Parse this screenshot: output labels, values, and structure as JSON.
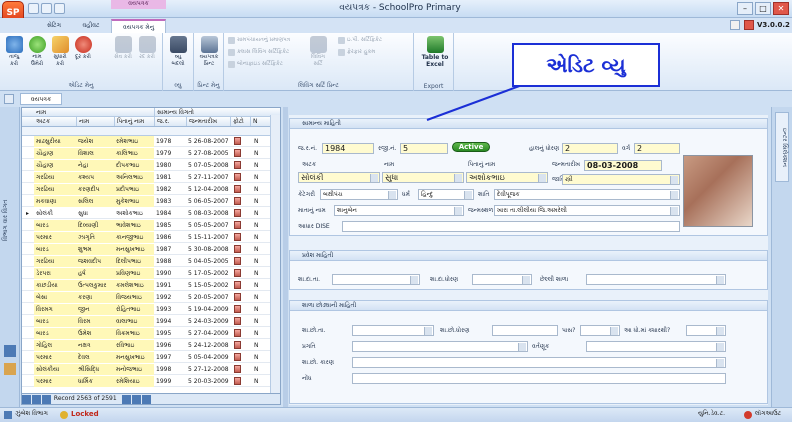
{
  "app": {
    "title": "વયપત્રક - SchoolPro Primary",
    "version": "V3.0.0.2",
    "logo": "SP"
  },
  "context_tab": "વયપત્રક",
  "ribbon_tabs": [
    "સેટિંગ",
    "વહીવટ",
    "વયપત્રક મેનુ"
  ],
  "ribbon": {
    "groups": [
      {
        "label": "એડિટ મેનુ",
        "buttons": [
          "તાજુ કરો",
          "નામ ઉમેરો",
          "સુધારો કરો",
          "દૂર કરો",
          "સેવ કરો",
          "રદ કરો"
        ]
      },
      {
        "label": "વ્યુ",
        "buttons": [
          "વ્યુ બદલો"
        ]
      },
      {
        "label": "પ્રિન્ટ મેનુ",
        "buttons": [
          "વયપત્રક પ્રિન્ટ"
        ]
      },
      {
        "label": "લિવિંગ સર્ટિ પ્રિન્ટ",
        "buttons": [
          "લિવિંગ સર્ટિ",
          "ન છ નબ મોડો"
        ]
      },
      {
        "label": "Export",
        "buttons": [
          "Table to Excel"
        ]
      }
    ],
    "small_items": [
      "ગ્રામપંચાયતનું પ્રમાણપત્ર",
      "ક્લાસ લિવિંગ સર્ટિફિકેટ",
      "બોનાફાઇડ સર્ટિફિકેટ",
      "ઇ.પી. સર્ટિફિકેટ",
      "ફેરફાર હુકમ"
    ]
  },
  "doc_tab": "વયપત્રક",
  "left_rail": "વિભાગ વાર વિગત",
  "right_rail": "ઇન્ટર સિલેક્શન",
  "grid": {
    "group_headers": [
      "નામ",
      "સામાન્ય વિગતો"
    ],
    "columns": [
      "અટક",
      "નામ",
      "પિતાનું નામ",
      "જ.ર.",
      "જન્મતારીખ",
      "ફોટો",
      "N"
    ],
    "rows": [
      [
        "માઢસુરીયા",
        "જયેશ",
        "રમેશભાઇ",
        "1978",
        "5 26-08-2007"
      ],
      [
        "ચૌહાણ",
        "વિશાલ",
        "કાલિભાઇ",
        "1979",
        "5 27-08-2005"
      ],
      [
        "ચૌહાણ",
        "નેહા",
        "દીપકભાઇ",
        "1980",
        "5 07-05-2008"
      ],
      [
        "ગરઢિયા",
        "કશ્યપ",
        "અનિલભાઇ",
        "1981",
        "5 27-11-2007"
      ],
      [
        "ગરઢિયા",
        "કરણદીપ",
        "પ્રદીપભાઇ",
        "1982",
        "5 12-04-2008"
      ],
      [
        "મકવાણા",
        "સલિલ",
        "મુકેશભાઇ",
        "1983",
        "5 06-05-2007"
      ],
      [
        "સોલંકી",
        "સુધા",
        "અશોકભાઇ",
        "1984",
        "5 08-03-2008"
      ],
      [
        "બારડ",
        "દિવ્યાણી",
        "ભાવેશભાઇ",
        "1985",
        "5 05-05-2007"
      ],
      [
        "પરમાર",
        "ઝાગૃતિ",
        "કાનજીભાઇ",
        "1986",
        "5 15-11-2007"
      ],
      [
        "બારડ",
        "શુભમ",
        "મનસુખભાઇ",
        "1987",
        "5 30-08-2008"
      ],
      [
        "ગરઢિયા",
        "જશવદીપ",
        "દિલીપભાઇ",
        "1988",
        "5 04-05-2005"
      ],
      [
        "ડેરપરા",
        "હર્ષ",
        "પ્રવિણભાઇ",
        "1990",
        "5 17-05-2002"
      ],
      [
        "કાછડીયા",
        "ઉત્પલકુમાર",
        "કમલેશભાઇ",
        "1991",
        "5 15-05-2002"
      ],
      [
        "બેસા",
        "કરણા",
        "વિજયભાઇ",
        "1992",
        "5 20-05-2007"
      ],
      [
        "વિરમગ",
        "જીન",
        "રોહિતભાઇ",
        "1993",
        "5 19-04-2009"
      ],
      [
        "બારડ",
        "વિરમ",
        "વાલાભાઇ",
        "1994",
        "5 24-03-2009"
      ],
      [
        "બારડ",
        "ઉમેશ",
        "વિક્રમભાઇ",
        "1995",
        "5 27-04-2009"
      ],
      [
        "ગોહિલ",
        "નક્ષત્ર",
        "રવિભાઇ",
        "1996",
        "5 24-12-2008"
      ],
      [
        "પરમાર",
        "દેવલ",
        "મનસુખભાઇ",
        "1997",
        "5 05-04-2009"
      ],
      [
        "સોલંકીયા",
        "શ્રીસિદ્ધિ",
        "મનોજભાઇ",
        "1998",
        "5 27-12-2008"
      ],
      [
        "પરમાર",
        "ધાર્મિક",
        "રમેશિયાઇ",
        "1999",
        "5 20-03-2009"
      ]
    ],
    "footer": "Record 2563 of 2591"
  },
  "form": {
    "general": {
      "title": "સામાન્ય માહિતી",
      "labels": {
        "gr_no": "જ.ર.નં.",
        "reg_no": "રજી.નં.",
        "current_std": "હાલનું ધોરણ",
        "division": "વર્ગ",
        "surname": "અટક",
        "name": "નામ",
        "father": "પિતાનું નામ",
        "dob": "જન્મતારીખ",
        "caste": "જાતિ",
        "category": "કેટેગરી",
        "religion": "ધર્મ",
        "subcaste": "શાતિ",
        "mother": "માતાનું નામ",
        "birthplace": "જન્મસ્થળ",
        "aadhaar": "આધાર DISE"
      },
      "values": {
        "gr_no": "1984",
        "reg_no": "5",
        "status": "Active",
        "current_std": "2",
        "division": "2",
        "surname": "સોલંકી",
        "name": "સુધા",
        "father": "અશોકભાઇ",
        "dob": "08-03-2008",
        "caste": "સ્ત્રી",
        "category": "બક્ષીપંચ",
        "religion": "હિન્દુ",
        "subcaste": "દેવીપૂજક",
        "mother": "શાનુબેન",
        "birthplace": "ખારા તા.લીલીયા જિ.અમરેલી",
        "aadhaar": ""
      }
    },
    "admission": {
      "title": "પ્રવેશ માહિતી",
      "labels": {
        "adm_date": "શા.દા.તા.",
        "adm_std": "શા.દા.ધોરણ",
        "last_school": "છેલ્લી શાળા"
      }
    },
    "leaving": {
      "title": "શાળા છોડ્યાની માહિતી",
      "labels": {
        "leave_date": "શા.છો.તા.",
        "leave_std": "શા.છો.ધોરણ",
        "pass": "પાસ?",
        "year": "આ ધો.માં ક્યારથી?",
        "progress": "પ્રગતિ",
        "conduct": "વર્તણૂક",
        "reason": "શા.છો. કારણ",
        "note": "નોંધ"
      }
    }
  },
  "callout": "એડિટ વ્યુ",
  "status": {
    "left": "ઝુંબેશ વિભાગ",
    "locked": "Locked",
    "right": "યુનિ.ડેવ.ટ.",
    "logout": "લૉગઆઉટ"
  },
  "colors": {
    "accent": "#c06bbd",
    "badge": "#2a8a24",
    "callout": "#1b2fd6",
    "field": "#fffbd0"
  }
}
